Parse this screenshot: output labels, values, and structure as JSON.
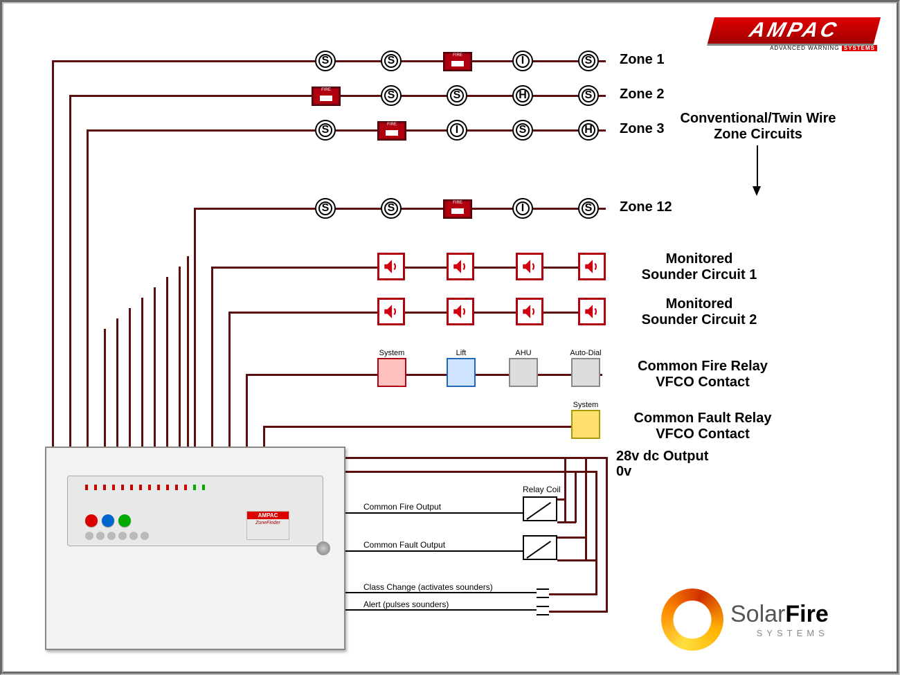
{
  "zones": {
    "header": "Conventional/Twin Wire\nZone Circuits",
    "rows": [
      {
        "label": "Zone 1",
        "devices": [
          "S",
          "S",
          "MCP",
          "I",
          "S"
        ]
      },
      {
        "label": "Zone 2",
        "devices": [
          "MCP",
          "S",
          "S",
          "H",
          "S"
        ]
      },
      {
        "label": "Zone 3",
        "devices": [
          "S",
          "MCP",
          "I",
          "S",
          "H"
        ]
      },
      {
        "label": "Zone 12",
        "devices": [
          "S",
          "S",
          "MCP",
          "I",
          "S"
        ]
      }
    ]
  },
  "sounder_circuits": [
    {
      "label": "Monitored\nSounder Circuit 1"
    },
    {
      "label": "Monitored\nSounder Circuit 2"
    }
  ],
  "relay_rows": [
    {
      "label": "Common Fire Relay\nVFCO Contact",
      "items": [
        {
          "cap": "System",
          "style": "red"
        },
        {
          "cap": "Lift",
          "style": "blue"
        },
        {
          "cap": "AHU",
          "style": "metal"
        },
        {
          "cap": "Auto-Dial",
          "style": "metal"
        }
      ]
    },
    {
      "label": "Common Fault Relay\nVFCO Contact",
      "items": [
        {
          "cap": "System",
          "style": "yellow"
        }
      ]
    }
  ],
  "dc_outputs": {
    "pos": "28v dc Output",
    "neg": "0v"
  },
  "panel_right": {
    "relay_caption": "Relay Coil",
    "outputs": [
      "Common Fire Output",
      "Common Fault Output"
    ],
    "switches": [
      "Class Change (activates sounders)",
      "Alert (pulses sounders)"
    ]
  },
  "logos": {
    "ampac": {
      "title": "AMPAC",
      "tag": "ADVANCED WARNING",
      "sys": "SYSTEMS"
    },
    "solarfire": {
      "a": "Solar",
      "b": "Fire",
      "c": "SYSTEMS"
    }
  },
  "mcp_text": "FIRE"
}
